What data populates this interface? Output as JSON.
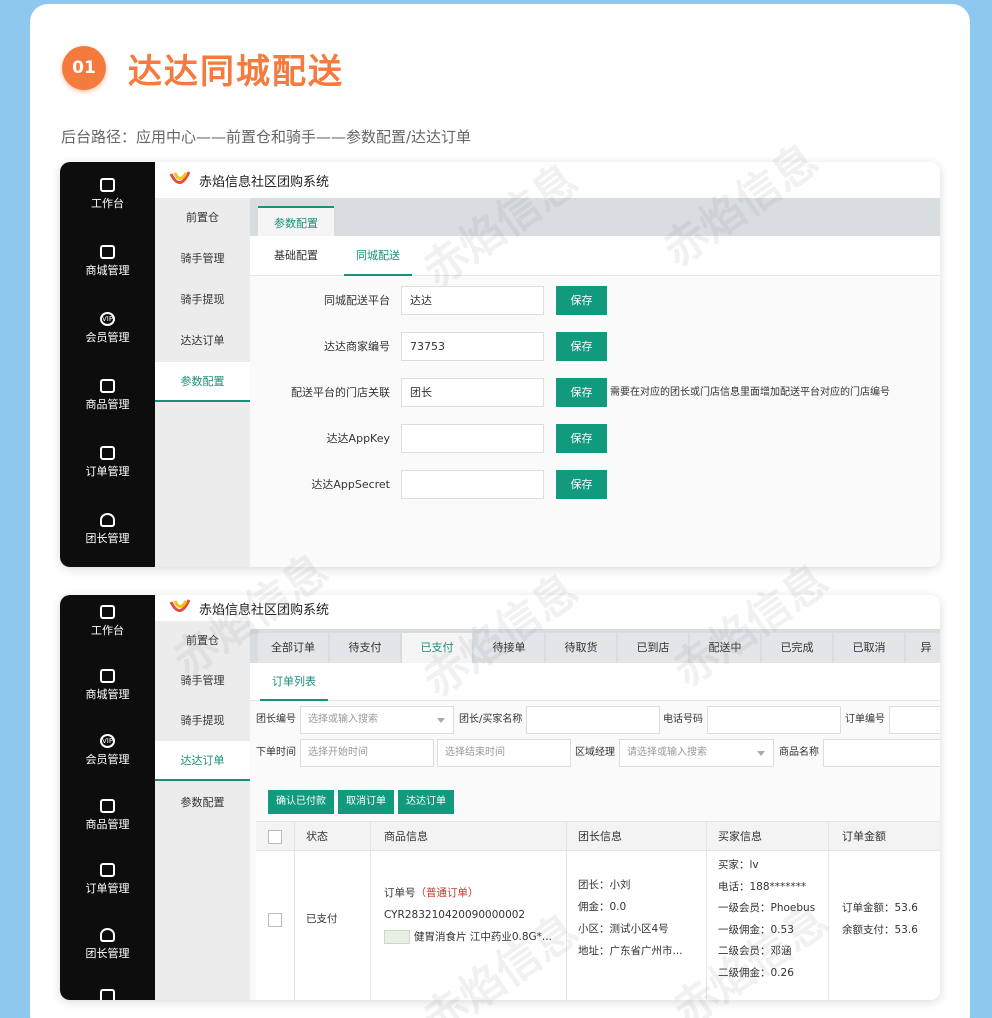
{
  "header": {
    "number": "01",
    "title": "达达同城配送",
    "path": "后台路径：应用中心——前置仓和骑手——参数配置/达达订单"
  },
  "app": {
    "name": "赤焰信息社区团购系统",
    "watermark": "赤焰信息"
  },
  "nav": [
    {
      "label": "工作台",
      "icon": "dashboard-icon"
    },
    {
      "label": "商城管理",
      "icon": "store-icon"
    },
    {
      "label": "会员管理",
      "icon": "vip-icon"
    },
    {
      "label": "商品管理",
      "icon": "goods-icon"
    },
    {
      "label": "订单管理",
      "icon": "order-icon"
    },
    {
      "label": "团长管理",
      "icon": "leader-icon"
    }
  ],
  "subnav": [
    "前置仓",
    "骑手管理",
    "骑手提现",
    "达达订单",
    "参数配置"
  ],
  "config": {
    "tab": "参数配置",
    "subtabs": [
      "基础配置",
      "同城配送"
    ],
    "rows": [
      {
        "label": "同城配送平台",
        "value": "达达",
        "button": "保存",
        "hint": ""
      },
      {
        "label": "达达商家编号",
        "value": "73753",
        "button": "保存",
        "hint": ""
      },
      {
        "label": "配送平台的门店关联",
        "value": "团长",
        "button": "保存",
        "hint": "需要在对应的团长或门店信息里面增加配送平台对应的门店编号"
      },
      {
        "label": "达达AppKey",
        "value": "",
        "button": "保存",
        "hint": ""
      },
      {
        "label": "达达AppSecret",
        "value": "",
        "button": "保存",
        "hint": ""
      }
    ]
  },
  "orders": {
    "tabs": [
      "全部订单",
      "待支付",
      "已支付",
      "待接单",
      "待取货",
      "已到店",
      "配送中",
      "已完成",
      "已取消",
      "异"
    ],
    "list_tab": "订单列表",
    "filters": {
      "leader_no": "团长编号",
      "leader_ph": "选择或输入搜索",
      "buyer": "团长/买家名称",
      "phone": "电话号码",
      "order_no": "订单编号",
      "time": "下单时间",
      "start_ph": "选择开始时间",
      "end_ph": "选择结束时间",
      "region": "区域经理",
      "region_ph": "请选择或输入搜索",
      "goods": "商品名称"
    },
    "actions": [
      "确认已付款",
      "取消订单",
      "达达订单"
    ],
    "columns": [
      "状态",
      "商品信息",
      "团长信息",
      "买家信息",
      "订单金额"
    ],
    "row": {
      "status": "已支付",
      "order_label": "订单号",
      "order_type": "（普通订单）",
      "order_no": "CYR283210420090000002",
      "goods": "健胃消食片 江中药业0.8G*...",
      "leader": [
        "团长：小刘",
        "佣金：0.0",
        "小区：测试小区4号",
        "地址：广东省广州市..."
      ],
      "buyer": [
        "买家：lv",
        "电话：188*******",
        "一级会员：Phoebus",
        "一级佣金：0.53",
        "二级会员：邓涵",
        "二级佣金：0.26"
      ],
      "amount": [
        "订单金额：53.6",
        "余额支付：53.6"
      ]
    }
  }
}
